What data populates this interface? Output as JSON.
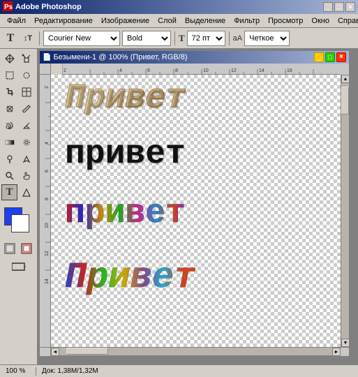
{
  "app": {
    "title": "Adobe Photoshop",
    "icon": "PS"
  },
  "menu": {
    "items": [
      "Файл",
      "Редактирование",
      "Изображение",
      "Слой",
      "Выделение",
      "Фильтр",
      "Просмотр",
      "Окно",
      "Справк..."
    ]
  },
  "toolbar": {
    "text_tool_label": "T",
    "orient_btn": "↕T",
    "font_label": "Courier New",
    "style_label": "Bold",
    "size_icon": "T",
    "size_value": "72 пт",
    "aa_icon": "аА",
    "aa_value": "Четкое"
  },
  "document": {
    "title": "Безымени-1 @ 100% (Привет, RGB/8)",
    "icon": "📄"
  },
  "canvas": {
    "text_layers": [
      {
        "text": "Привет",
        "style": "outlined-gold-italic"
      },
      {
        "text": "привет",
        "style": "black-bold"
      },
      {
        "text": "привет",
        "style": "colorful"
      },
      {
        "text": "Привет",
        "style": "colorful-italic"
      }
    ]
  },
  "status": {
    "zoom": "100 %",
    "doc_info": "Док: 1,38M/1,32M"
  },
  "tools": {
    "rows": [
      [
        "→",
        "⊹"
      ],
      [
        "⊡",
        "◎"
      ],
      [
        "✂",
        "⌗"
      ],
      [
        "✒",
        "✏"
      ],
      [
        "⌂",
        "◈"
      ],
      [
        "🖌",
        "✦"
      ],
      [
        "🔧",
        "💧"
      ],
      [
        "🔍",
        "🤚"
      ],
      [
        "T",
        "A"
      ]
    ]
  }
}
